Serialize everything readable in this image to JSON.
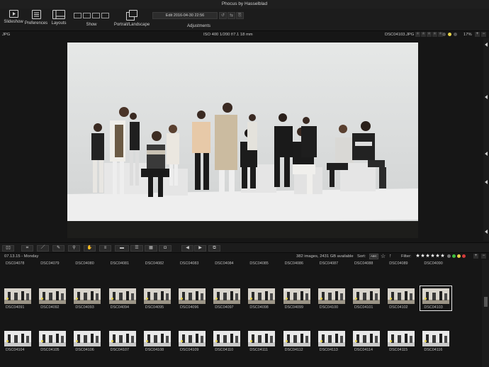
{
  "window": {
    "title": "Phocus by Hasselblad"
  },
  "toolbar": {
    "slideshow": "Slideshow",
    "preferences": "Preferences",
    "layouts": "Layouts",
    "show": "Show",
    "portrait_landscape": "Portrait/Landscape",
    "adjustments": "Adjustments",
    "edit_field": "Edit 2016-04-30 22:56"
  },
  "infobar": {
    "format": "JPG",
    "exif": "ISO 400  1/200  f/7.1  18 mm",
    "filename": "DSC04103.JPG",
    "zoom": "17%"
  },
  "status": {
    "date": "07.13.15 - Monday",
    "count": "382  images, 2431 GB available",
    "sort_label": "Sort:",
    "sort_value": "ABC",
    "filter_label": "Filter:"
  },
  "colors": {
    "accent_yellow": "#e8d44a",
    "dot_green": "#3fbf3f",
    "dot_red": "#d23b3b",
    "selection": "#e8e8e8"
  },
  "thumbnails": {
    "row1": [
      "DSC04078",
      "DSC04079",
      "DSC04080",
      "DSC04081",
      "DSC04082",
      "DSC04083",
      "DSC04084",
      "DSC04085",
      "DSC04086",
      "DSC04087",
      "DSC04088",
      "DSC04089",
      "DSC04090"
    ],
    "row2": [
      "DSC04091",
      "DSC04092",
      "DSC04093",
      "DSC04094",
      "DSC04095",
      "DSC04096",
      "DSC04097",
      "DSC04098",
      "DSC04099",
      "DSC04100",
      "DSC04101",
      "DSC04102",
      "DSC04103"
    ],
    "row3": [
      "DSC04104",
      "DSC04105",
      "DSC04106",
      "DSC04107",
      "DSC04108",
      "DSC04109",
      "DSC04110",
      "DSC04111",
      "DSC04112",
      "DSC04113",
      "DSC04114",
      "DSC04115",
      "DSC04116"
    ],
    "selected": "DSC04103",
    "jpg_badge": "JPG"
  }
}
